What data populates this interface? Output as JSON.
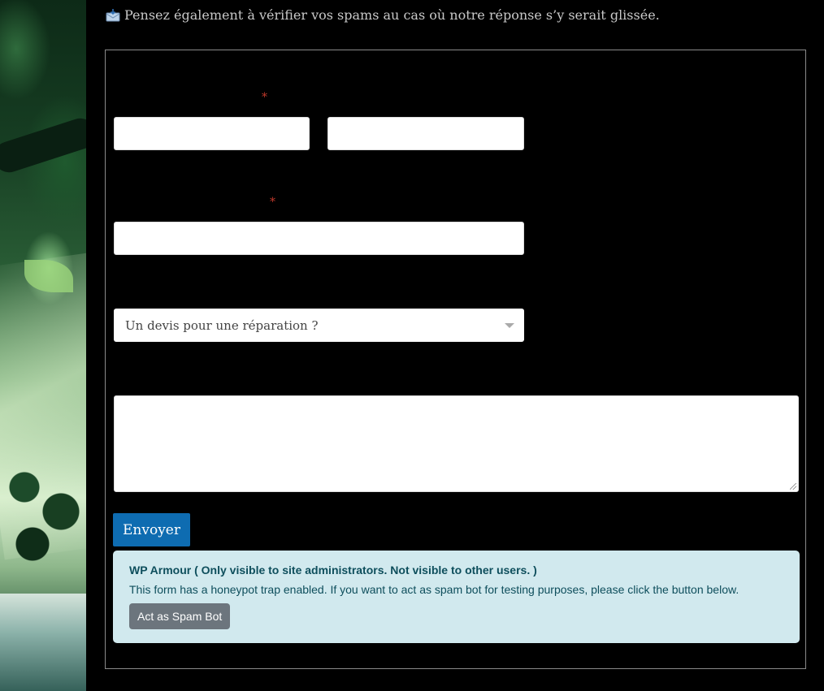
{
  "notice": {
    "icon": "incoming-envelope-icon",
    "text": "Pensez également à vérifier vos spams au cas où notre réponse s’y serait glissée."
  },
  "form": {
    "required_marker": "*",
    "first_name": {
      "value": "",
      "placeholder": ""
    },
    "last_name": {
      "value": "",
      "placeholder": ""
    },
    "email": {
      "value": "",
      "placeholder": ""
    },
    "subject_select": {
      "selected": "Un devis pour une réparation ?"
    },
    "message": {
      "value": "",
      "placeholder": ""
    },
    "submit_label": "Envoyer"
  },
  "wp_armour": {
    "title": "WP Armour ( Only visible to site administrators. Not visible to other users. )",
    "description": "This form has a honeypot trap enabled. If you want to act as spam bot for testing purposes, please click the button below.",
    "button_label": "Act as Spam Bot"
  },
  "colors": {
    "background": "#000000",
    "submit_button": "#0e6cb1",
    "notice_box": "#d1e9ee",
    "spam_button": "#6c757d",
    "required_marker": "#c0392b"
  }
}
